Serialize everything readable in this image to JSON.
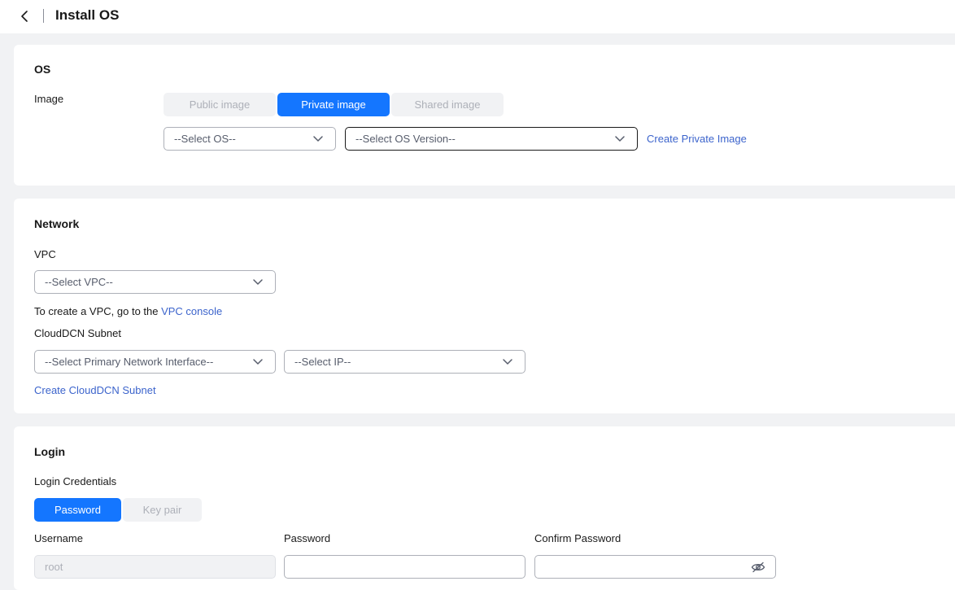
{
  "header": {
    "title": "Install OS"
  },
  "os": {
    "section_title": "OS",
    "image_label": "Image",
    "image_tabs": [
      "Public image",
      "Private image",
      "Shared image"
    ],
    "selected_tab": "Private image",
    "os_select_placeholder": "--Select OS--",
    "os_version_placeholder": "--Select OS Version--",
    "create_private_image_link": "Create Private Image"
  },
  "network": {
    "section_title": "Network",
    "vpc_label": "VPC",
    "vpc_select_placeholder": "--Select VPC--",
    "vpc_hint_prefix": "To create a VPC, go to the ",
    "vpc_console_link": "VPC console",
    "subnet_label": "CloudDCN Subnet",
    "primary_nic_placeholder": "--Select Primary Network Interface--",
    "ip_placeholder": "--Select IP--",
    "create_subnet_link": "Create CloudDCN Subnet"
  },
  "login": {
    "section_title": "Login",
    "credentials_label": "Login Credentials",
    "credential_tabs": [
      "Password",
      "Key pair"
    ],
    "selected_credential": "Password",
    "username_label": "Username",
    "username_value": "root",
    "password_label": "Password",
    "confirm_password_label": "Confirm Password"
  },
  "icons": {
    "back": "chevron-left-icon",
    "dropdown": "chevron-down-icon",
    "visibility": "eye-off-icon"
  },
  "colors": {
    "accent": "#1476ff",
    "link": "#3c64cc",
    "background": "#f1f2f4"
  }
}
